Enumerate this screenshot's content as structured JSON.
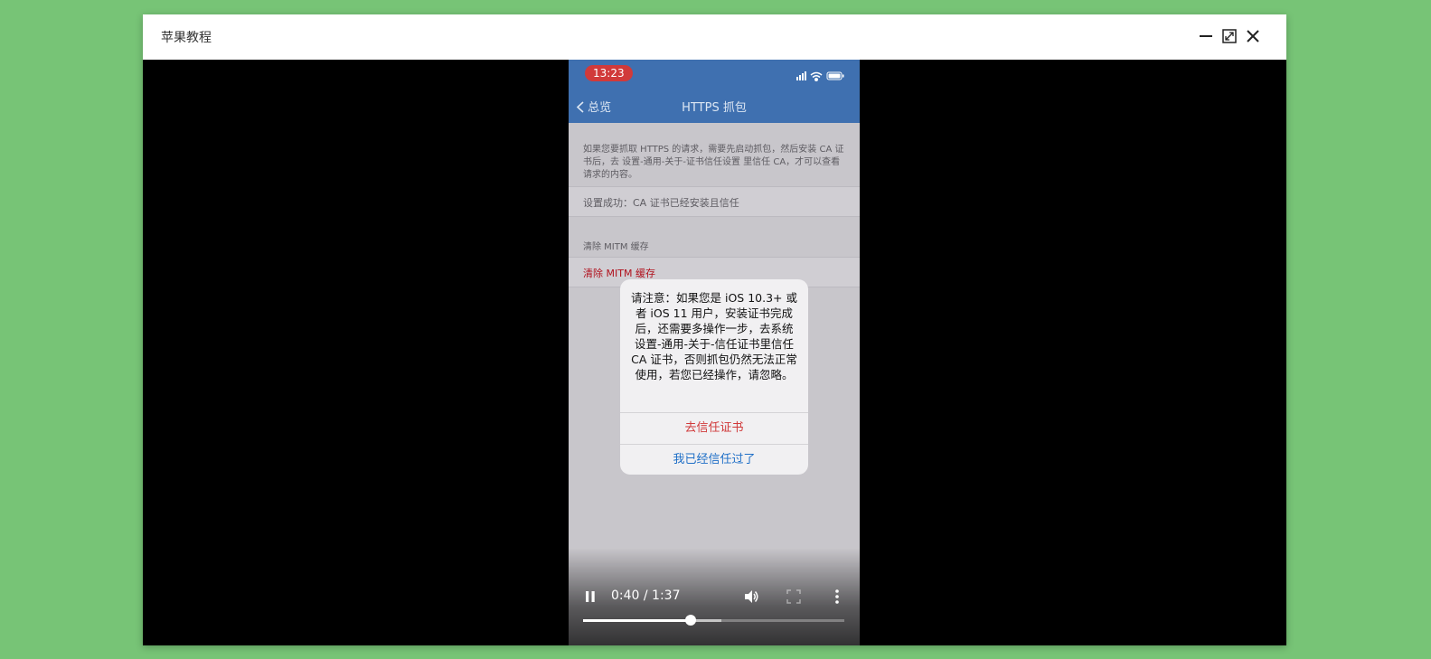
{
  "window": {
    "title": "苹果教程"
  },
  "phone": {
    "status_time": "13:23",
    "nav": {
      "back_label": "总览",
      "title": "HTTPS 抓包"
    },
    "description": "如果您要抓取 HTTPS 的请求，需要先启动抓包，然后安装 CA 证书后，去 设置-通用-关于-证书信任设置 里信任 CA，才可以查看请求的内容。",
    "status_cell": "设置成功：CA 证书已经安装且信任",
    "group_header": "清除 MITM 缓存",
    "clear_cell": "清除 MITM 缓存",
    "alert": {
      "message": "请注意：如果您是 iOS 10.3+ 或者 iOS 11 用户，安装证书完成后，还需要多操作一步，去系统设置-通用-关于-信任证书里信任 CA 证书，否则抓包仍然无法正常使用，若您已经操作，请忽略。",
      "primary_button": "去信任证书",
      "secondary_button": "我已经信任过了"
    }
  },
  "player": {
    "timecode": "0:40 / 1:37",
    "progress": 0.412,
    "buffered": 0.53
  },
  "colors": {
    "background": "#77c476",
    "nav_bar": "#3f70b0",
    "time_pill": "#d13a3a",
    "alert_red": "#d0393a",
    "alert_blue": "#1f6fc7",
    "red_cell_text": "#b0101c"
  },
  "icons": [
    "minimize-icon",
    "maximize-icon",
    "close-icon",
    "pause-icon",
    "volume-icon",
    "fullscreen-icon",
    "more-icon",
    "signal-icon",
    "wifi-icon",
    "battery-icon",
    "chevron-left-icon"
  ]
}
